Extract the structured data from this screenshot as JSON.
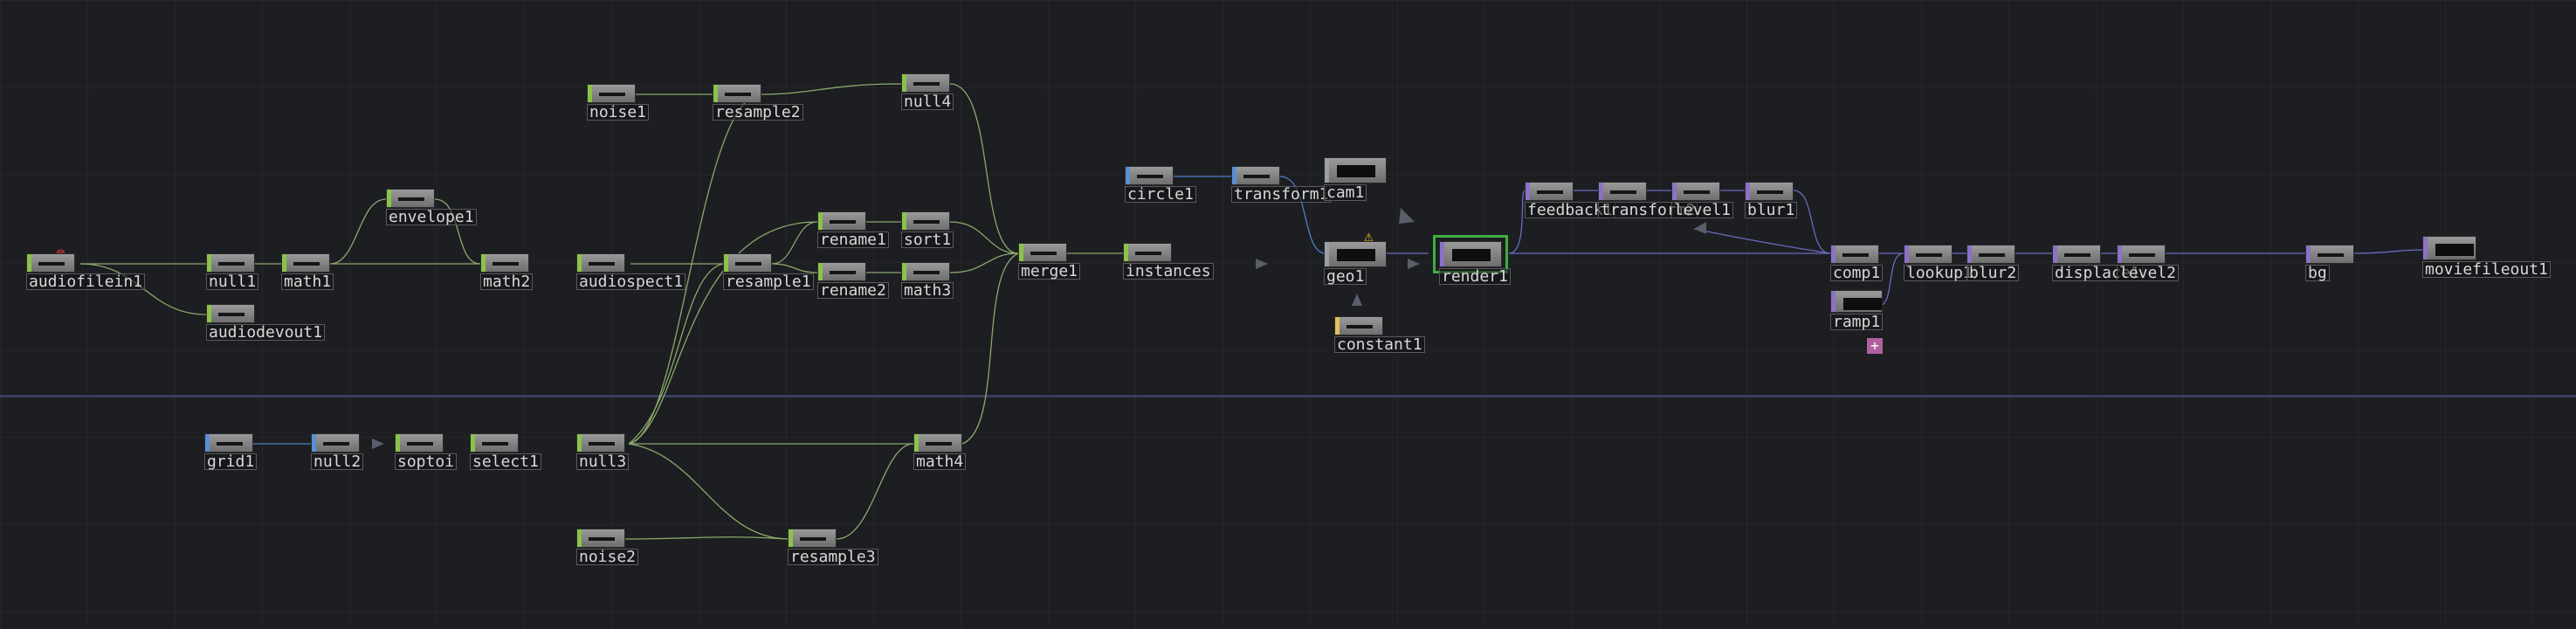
{
  "network": {
    "title": "",
    "families": {
      "chop": "#8bc34a",
      "top": "#8b72c7",
      "sop": "#5a8fd6",
      "mat": "#e0c060",
      "comp": "#9aa0a8"
    },
    "icons": {
      "error": "error-icon",
      "warning": "warning-icon",
      "add": "add-icon"
    },
    "badges": {
      "error_glyph": "⊗",
      "warning_glyph": "⚠",
      "add_glyph": "+"
    },
    "nodes": {
      "noise1": "noise1",
      "resample2": "resample2",
      "null4": "null4",
      "envelope1": "envelope1",
      "audiofilein1": "audiofilein1",
      "null1": "null1",
      "math1": "math1",
      "math2": "math2",
      "audiodevout1": "audiodevout1",
      "audiospect1": "audiospect1",
      "resample1": "resample1",
      "rename1": "rename1",
      "sort1": "sort1",
      "rename2": "rename2",
      "math3": "math3",
      "merge1": "merge1",
      "instances": "instances",
      "circle1": "circle1",
      "transform1": "transform1",
      "cam1": "cam1",
      "geo1": "geo1",
      "constant1": "constant1",
      "render1": "render1",
      "feedback1": "feedback1",
      "transform2": "transform2",
      "level1": "level1",
      "blur1": "blur1",
      "comp1": "comp1",
      "ramp1": "ramp1",
      "lookup1": "lookup1",
      "blur2": "blur2",
      "displace1": "displace1",
      "level2": "level2",
      "bg": "bg",
      "moviefileout1": "moviefileout1",
      "grid1": "grid1",
      "null2": "null2",
      "soptoi": "soptoi",
      "select1": "select1",
      "null3": "null3",
      "math4": "math4",
      "noise2": "noise2",
      "resample3": "resample3"
    }
  }
}
